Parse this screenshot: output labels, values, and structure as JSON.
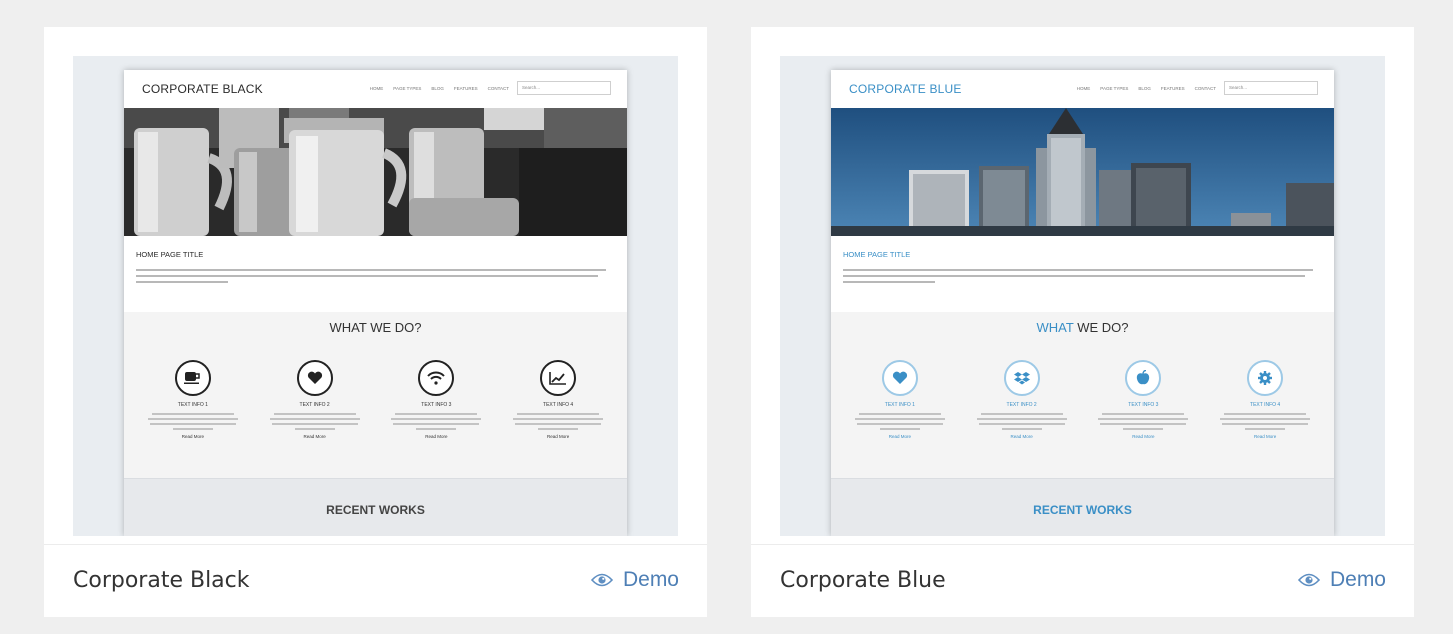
{
  "templates": [
    {
      "card_title": "Corporate Black",
      "demo_label": "Demo",
      "preview": {
        "logo": "CORPORATE BLACK",
        "nav": [
          "HOME",
          "PAGE TYPES",
          "BLOG",
          "FEATURES",
          "CONTACT"
        ],
        "search_placeholder": "Search...",
        "page_title": "HOME PAGE TITLE",
        "section_heading_accent": "WHAT",
        "section_heading_rest": " WE DO?",
        "features": [
          {
            "icon": "coffee-cup-icon",
            "label": "TEXT INFO 1",
            "more": "Read More"
          },
          {
            "icon": "heart-icon",
            "label": "TEXT INFO 2",
            "more": "Read More"
          },
          {
            "icon": "wifi-icon",
            "label": "TEXT INFO 3",
            "more": "Read More"
          },
          {
            "icon": "chart-icon",
            "label": "TEXT INFO 4",
            "more": "Read More"
          }
        ],
        "footer_heading": "RECENT WORKS"
      }
    },
    {
      "card_title": "Corporate Blue",
      "demo_label": "Demo",
      "preview": {
        "logo": "CORPORATE BLUE",
        "nav": [
          "HOME",
          "PAGE TYPES",
          "BLOG",
          "FEATURES",
          "CONTACT"
        ],
        "search_placeholder": "Search...",
        "page_title": "HOME PAGE TITLE",
        "section_heading_accent": "WHAT",
        "section_heading_rest": " WE DO?",
        "features": [
          {
            "icon": "heart-icon",
            "label": "TEXT INFO 1",
            "more": "Read More"
          },
          {
            "icon": "dropbox-icon",
            "label": "TEXT INFO 2",
            "more": "Read More"
          },
          {
            "icon": "apple-icon",
            "label": "TEXT INFO 3",
            "more": "Read More"
          },
          {
            "icon": "gear-icon",
            "label": "TEXT INFO 4",
            "more": "Read More"
          }
        ],
        "footer_heading": "RECENT WORKS"
      }
    }
  ],
  "colors": {
    "background": "#efefef",
    "card": "#ffffff",
    "demo_link": "#4e7fb5",
    "blue_accent": "#3a8fc6"
  }
}
